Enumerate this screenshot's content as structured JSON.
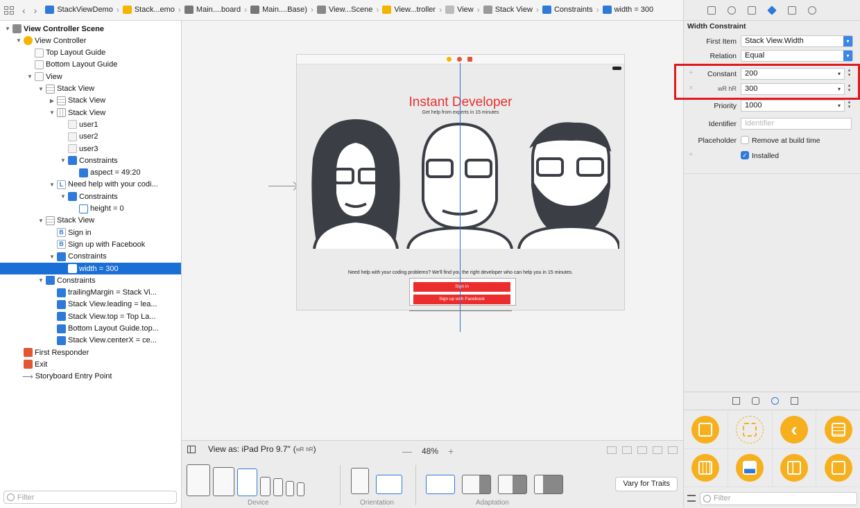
{
  "breadcrumbs": [
    {
      "label": "StackViewDemo",
      "icon": "project-icon",
      "color": "#2d7ad8"
    },
    {
      "label": "Stack...emo",
      "icon": "folder-icon",
      "color": "#f4b400"
    },
    {
      "label": "Main....board",
      "icon": "storyboard-icon",
      "color": "#777777"
    },
    {
      "label": "Main....Base)",
      "icon": "storyboard-icon",
      "color": "#777777"
    },
    {
      "label": "View...Scene",
      "icon": "scene-icon",
      "color": "#888888"
    },
    {
      "label": "View...troller",
      "icon": "view-controller-icon",
      "color": "#f4b400"
    },
    {
      "label": "View",
      "icon": "view-icon",
      "color": "#bbbbbb"
    },
    {
      "label": "Stack View",
      "icon": "stack-view-icon",
      "color": "#999999"
    },
    {
      "label": "Constraints",
      "icon": "constraints-icon",
      "color": "#2d7ad8"
    },
    {
      "label": "width = 300",
      "icon": "constraint-icon",
      "color": "#2d7ad8"
    }
  ],
  "outline": {
    "items": [
      {
        "label": "View Controller Scene",
        "bold": true
      },
      {
        "label": "View Controller"
      },
      {
        "label": "Top Layout Guide"
      },
      {
        "label": "Bottom Layout Guide"
      },
      {
        "label": "View"
      },
      {
        "label": "Stack View"
      },
      {
        "label": "Stack View"
      },
      {
        "label": "Stack View"
      },
      {
        "label": "user1"
      },
      {
        "label": "user2"
      },
      {
        "label": "user3"
      },
      {
        "label": "Constraints"
      },
      {
        "label": "aspect = 49:20"
      },
      {
        "label": "Need help with your codi..."
      },
      {
        "label": "Constraints"
      },
      {
        "label": "height = 0"
      },
      {
        "label": "Stack View"
      },
      {
        "label": "Sign in"
      },
      {
        "label": "Sign up with Facebook"
      },
      {
        "label": "Constraints"
      },
      {
        "label": "width = 300",
        "selected": true
      },
      {
        "label": "Constraints"
      },
      {
        "label": "trailingMargin = Stack Vi..."
      },
      {
        "label": "Stack View.leading = lea..."
      },
      {
        "label": "Stack View.top = Top La..."
      },
      {
        "label": "Bottom Layout Guide.top..."
      },
      {
        "label": "Stack View.centerX = ce..."
      },
      {
        "label": "First Responder"
      },
      {
        "label": "Exit"
      },
      {
        "label": "Storyboard Entry Point"
      }
    ],
    "filter_placeholder": "Filter"
  },
  "canvas": {
    "app_title": "Instant Developer",
    "app_subtitle": "Get help from experts in 15 minutes",
    "help_text": "Need help with your coding problems? We'll find you the right developer who can help you in 15 minutes.",
    "sign_in": "Sign in",
    "sign_up": "Sign up with Facebook"
  },
  "device_bar": {
    "view_as": "View as: iPad Pro 9.7\"",
    "traits_w": "wR",
    "traits_h": "hR",
    "zoom_minus": "—",
    "zoom": "48%",
    "zoom_plus": "+",
    "group_device": "Device",
    "group_orientation": "Orientation",
    "group_adaptation": "Adaptation",
    "vary_button": "Vary for Traits"
  },
  "inspector": {
    "section_title": "Width Constraint",
    "first_item_label": "First Item",
    "first_item_value": "Stack View.Width",
    "relation_label": "Relation",
    "relation_value": "Equal",
    "constant_label": "Constant",
    "constant_value": "200",
    "variation_label_w": "wR",
    "variation_label_h": "hR",
    "variation_value": "300",
    "priority_label": "Priority",
    "priority_value": "1000",
    "identifier_label": "Identifier",
    "identifier_placeholder": "Identifier",
    "placeholder_label": "Placeholder",
    "placeholder_check_label": "Remove at build time",
    "installed_label": "Installed",
    "library_filter_placeholder": "Filter"
  },
  "colors": {
    "accent": "#2d7ad8",
    "highlight": "#e0191f",
    "brand_red": "#e8312a",
    "library_yellow": "#f6b01e"
  }
}
